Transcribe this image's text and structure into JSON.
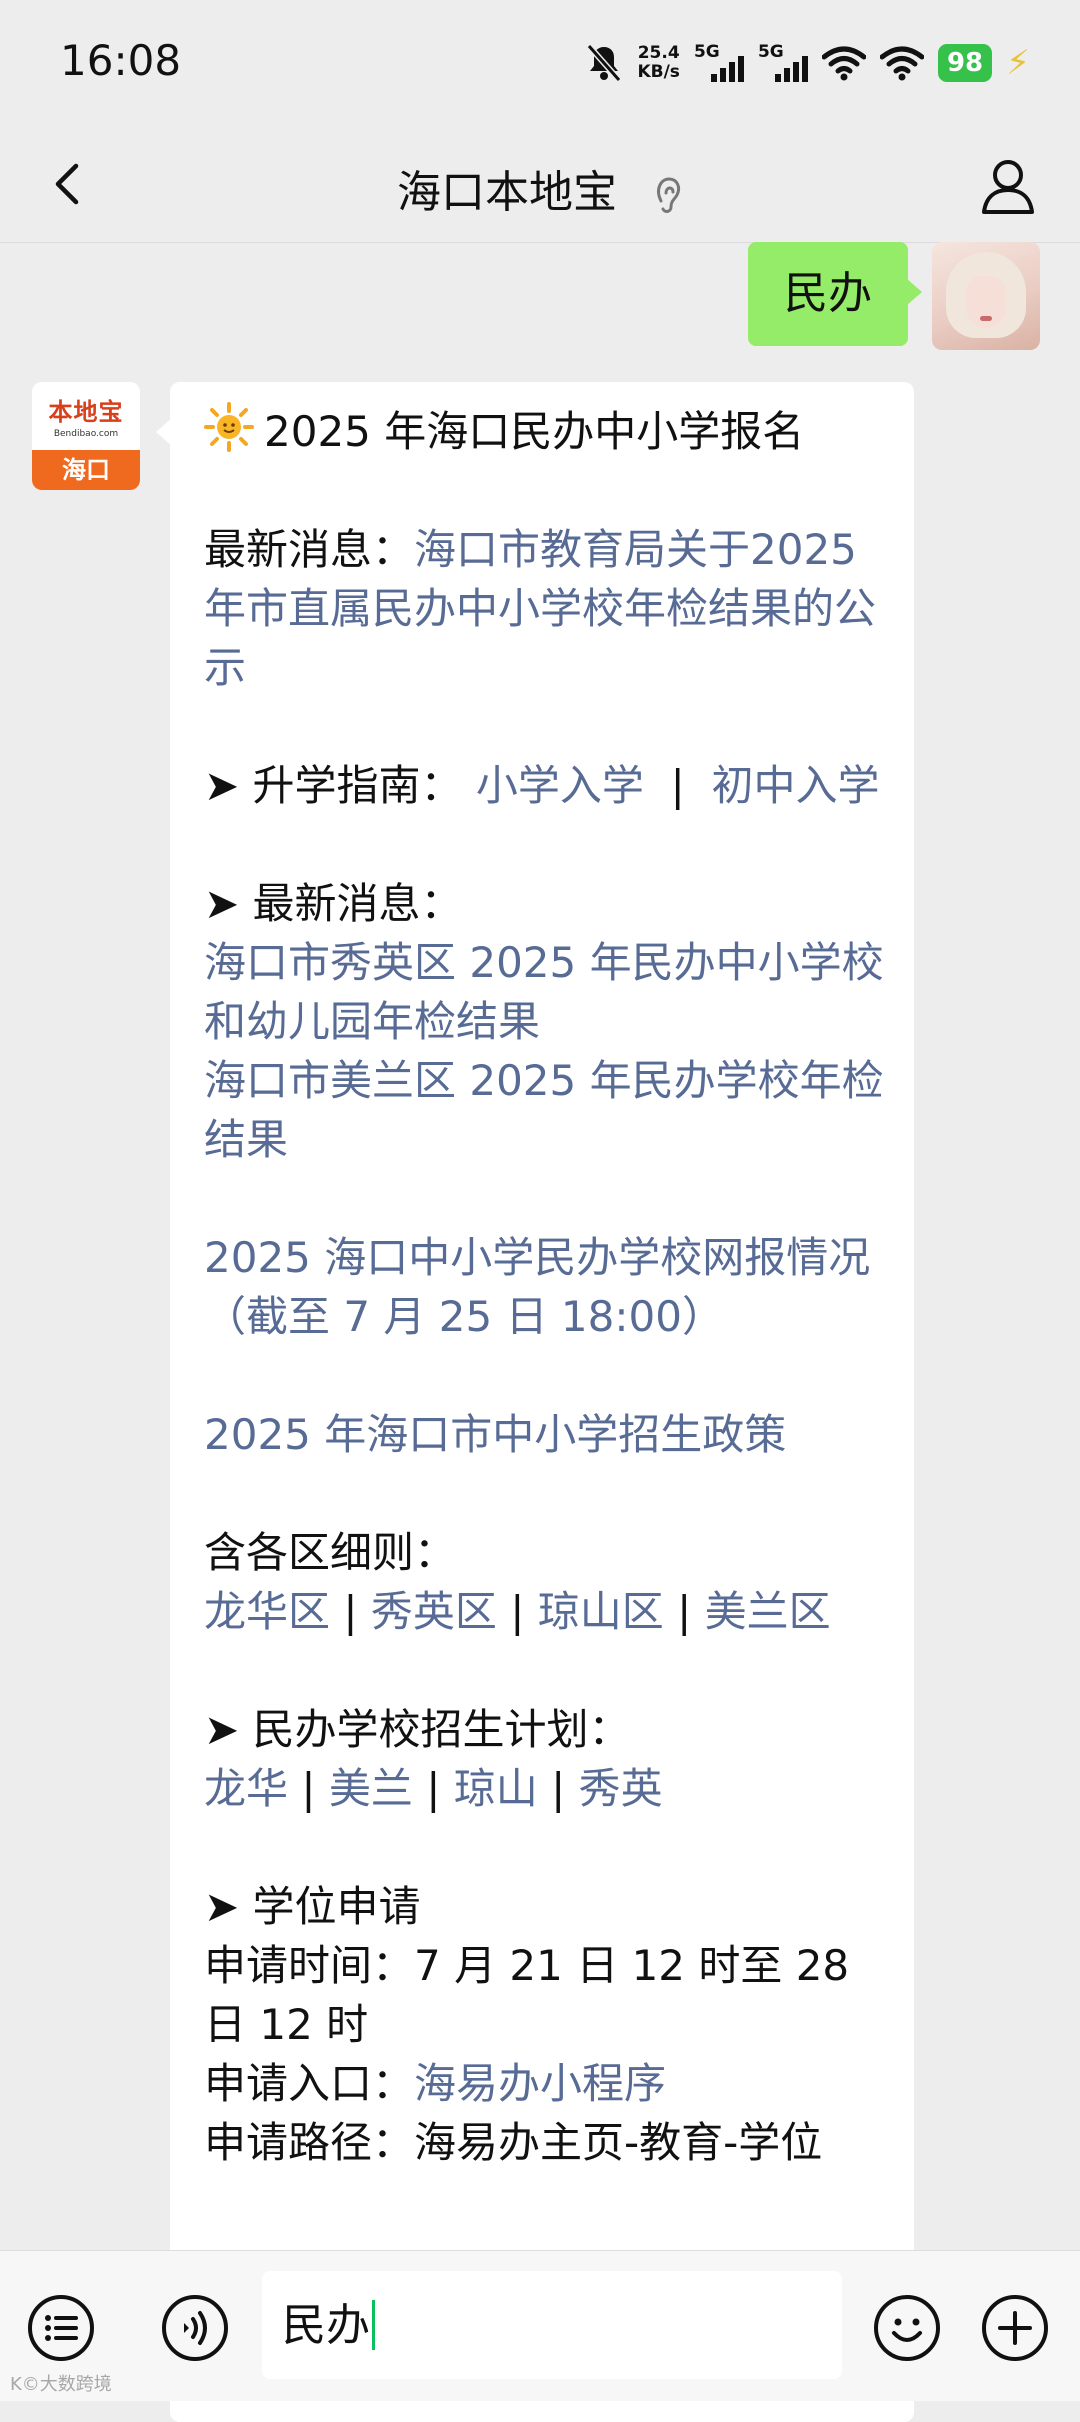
{
  "status_bar": {
    "time": "16:08",
    "net_speed_value": "25.4",
    "net_speed_unit": "KB/s",
    "signal1_label": "5G",
    "signal2_label": "5G",
    "battery": "98",
    "icons": [
      "mute-bell-icon",
      "signal-icon",
      "wifi-icon",
      "charging-icon"
    ]
  },
  "nav": {
    "title": "海口本地宝",
    "icons": [
      "back-icon",
      "ear-icon",
      "profile-icon"
    ]
  },
  "sent_message": {
    "text": "民办"
  },
  "bot": {
    "avatar_logo": "本地宝",
    "avatar_url": "Bendibao.com",
    "avatar_city": "海口"
  },
  "received_message": {
    "headline": "2025 年海口民办中小学报名",
    "news_label": "最新消息：",
    "news_link": "海口市教育局关于2025 年市直属民办中小学校年检结果的公示",
    "guide_label": "➤ 升学指南：",
    "guide_links": [
      "小学入学",
      "初中入学"
    ],
    "guide_sep": "|",
    "latest_label": "➤ 最新消息：",
    "latest_links": [
      "海口市秀英区 2025 年民办中小学校和幼儿园年检结果",
      "海口市美兰区 2025 年民办学校年检结果"
    ],
    "online_report_link": "2025 海口中小学民办学校网报情况（截至 7 月 25 日 18:00）",
    "policy_link": "2025 年海口市中小学招生政策",
    "districts_label": "含各区细则：",
    "districts": [
      "龙华区",
      "秀英区",
      "琼山区",
      "美兰区"
    ],
    "plan_label": "➤ 民办学校招生计划：",
    "plans": [
      "龙华",
      "美兰",
      "琼山",
      "秀英"
    ],
    "sep": " | ",
    "apply_label": "➤ 学位申请",
    "apply_time": "申请时间：7 月 21 日 12 时至 28 日 12 时",
    "apply_entry_label": "申请入口：",
    "apply_entry_link": "海易办小程序",
    "apply_path": "申请路径：海易办主页-教育-学位"
  },
  "input_bar": {
    "text": "民办",
    "icons": [
      "menu-list-icon",
      "voice-icon",
      "emoji-icon",
      "plus-icon"
    ]
  },
  "watermark": "K©大数跨境",
  "colors": {
    "link": "#576b95",
    "sent_bubble": "#95ec69",
    "accent": "#07c160"
  }
}
